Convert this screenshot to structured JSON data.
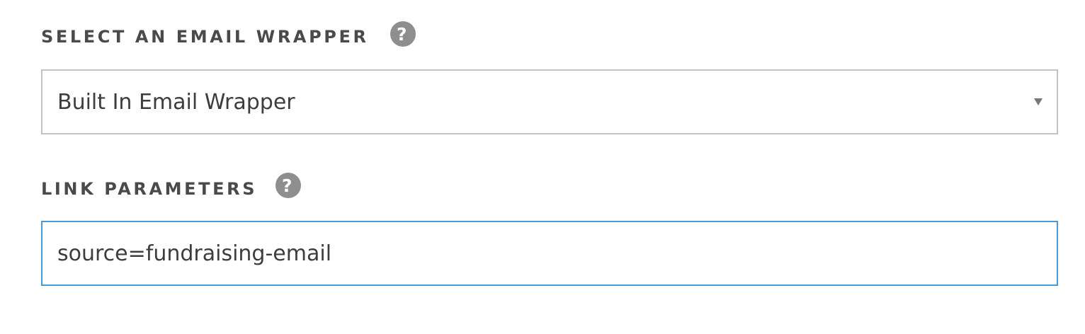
{
  "email_wrapper": {
    "label": "SELECT AN EMAIL WRAPPER",
    "help_icon": "question-circle-icon",
    "selected_value": "Built In Email Wrapper",
    "dropdown_icon": "caret-down-icon"
  },
  "link_parameters": {
    "label": "LINK PARAMETERS",
    "help_icon": "question-circle-icon",
    "value": "source=fundraising-email"
  },
  "colors": {
    "label_text": "#4a4a4a",
    "help_icon_bg": "#8e8e8e",
    "select_border": "#c2c2c2",
    "focused_input_border": "#4a9ad4"
  }
}
